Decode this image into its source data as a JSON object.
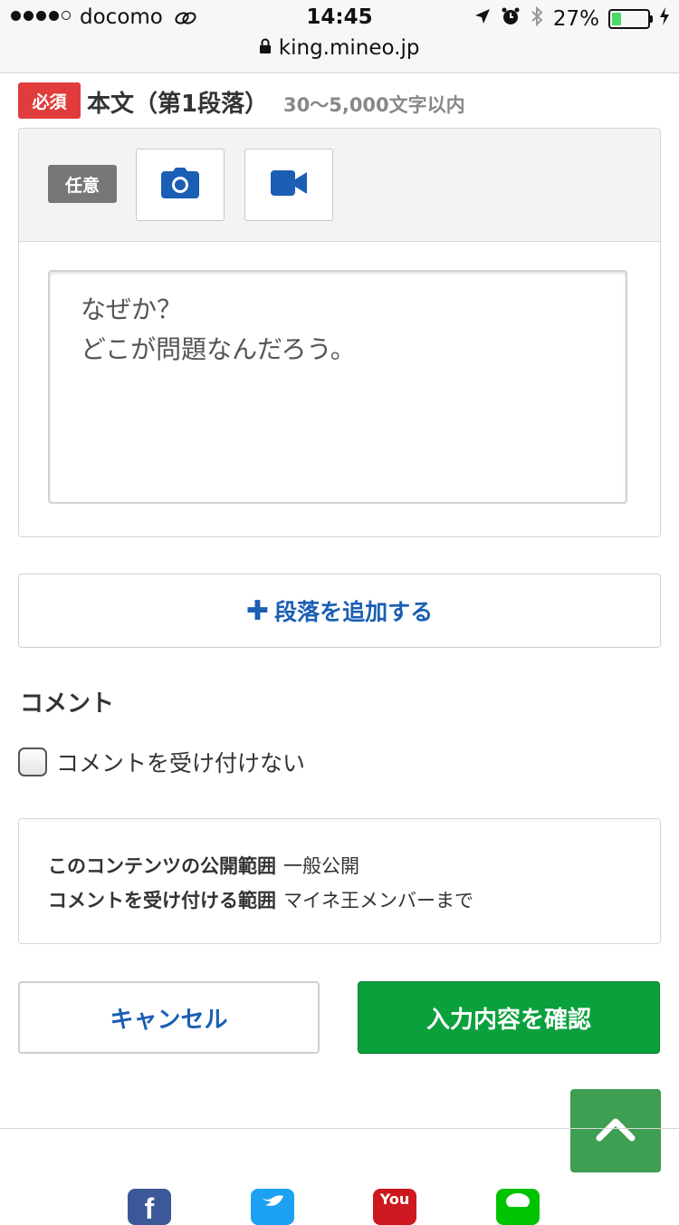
{
  "status_bar": {
    "carrier": "docomo",
    "time": "14:45",
    "battery_percent": "27%",
    "battery_level": 0.27,
    "url": "king.mineo.jp"
  },
  "form": {
    "required_badge": "必須",
    "field_title": "本文（第1段落）",
    "char_limit": "30〜5,000文字以内",
    "optional_badge": "任意",
    "body_text": "なぜか？\nどこが問題なんだろう。",
    "add_paragraph": "段落を追加する",
    "comment_heading": "コメント",
    "no_comment_label": "コメントを受け付けない",
    "visibility_label": "このコンテンツの公開範囲",
    "visibility_value": "一般公開",
    "comment_scope_label": "コメントを受け付ける範囲",
    "comment_scope_value": "マイネ王メンバーまで",
    "cancel": "キャンセル",
    "confirm": "入力内容を確認"
  },
  "footer": {
    "youtube_text": "You"
  },
  "colors": {
    "required": "#e13c3c",
    "link_blue": "#1a5fb4",
    "confirm_green": "#0aa03c",
    "to_top_green": "#3e9e52"
  }
}
